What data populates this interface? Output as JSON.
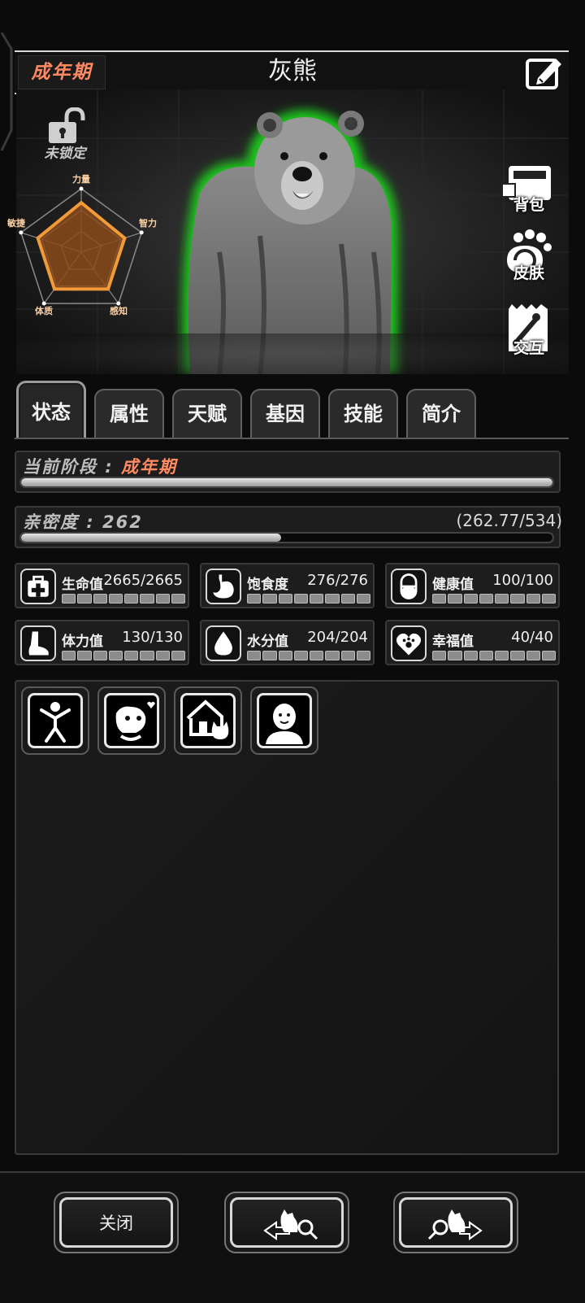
{
  "header": {
    "stage_tag": "成年期",
    "title": "灰熊"
  },
  "lock": {
    "label": "未锁定"
  },
  "radar": {
    "labels": {
      "top": "力量",
      "right": "智力",
      "bottom_right": "感知",
      "bottom_left": "体质",
      "left": "敏捷"
    },
    "values": {
      "top": 0.78,
      "right": 0.72,
      "bottom_right": 0.72,
      "bottom_left": 0.72,
      "left": 0.72
    },
    "fill_color": "#8a4a1a",
    "stroke_color": "#f09a3a"
  },
  "side_buttons": [
    {
      "label": "背包",
      "icon": "backpack-icon"
    },
    {
      "label": "皮肤",
      "icon": "paw-skin-icon"
    },
    {
      "label": "交互",
      "icon": "bone-bag-icon"
    }
  ],
  "tabs": [
    {
      "label": "状态",
      "active": true
    },
    {
      "label": "属性"
    },
    {
      "label": "天赋"
    },
    {
      "label": "基因"
    },
    {
      "label": "技能"
    },
    {
      "label": "简介"
    }
  ],
  "stage": {
    "label": "当前阶段 : ",
    "value": "成年期",
    "progress": 1.0
  },
  "affinity": {
    "label": "亲密度 : 262",
    "numbers": "(262.77/534)",
    "progress": 0.49
  },
  "stats": [
    {
      "name": "生命值",
      "value": "2665/2665",
      "icon": "first-aid-icon",
      "fill": 1.0
    },
    {
      "name": "饱食度",
      "value": "276/276",
      "icon": "stomach-icon",
      "fill": 1.0
    },
    {
      "name": "健康值",
      "value": "100/100",
      "icon": "pill-icon",
      "fill": 1.0
    },
    {
      "name": "体力值",
      "value": "130/130",
      "icon": "foot-icon",
      "fill": 1.0
    },
    {
      "name": "水分值",
      "value": "204/204",
      "icon": "water-drop-icon",
      "fill": 1.0
    },
    {
      "name": "幸福值",
      "value": "40/40",
      "icon": "heart-paw-icon",
      "fill": 1.0
    }
  ],
  "status_icons": [
    "stretch-figure-icon",
    "dog-heart-icon",
    "house-cat-icon",
    "person-head-icon"
  ],
  "bottom": {
    "close_label": "关闭"
  },
  "colors": {
    "accent": "#ff8a62",
    "glow": "#3cff3c"
  }
}
